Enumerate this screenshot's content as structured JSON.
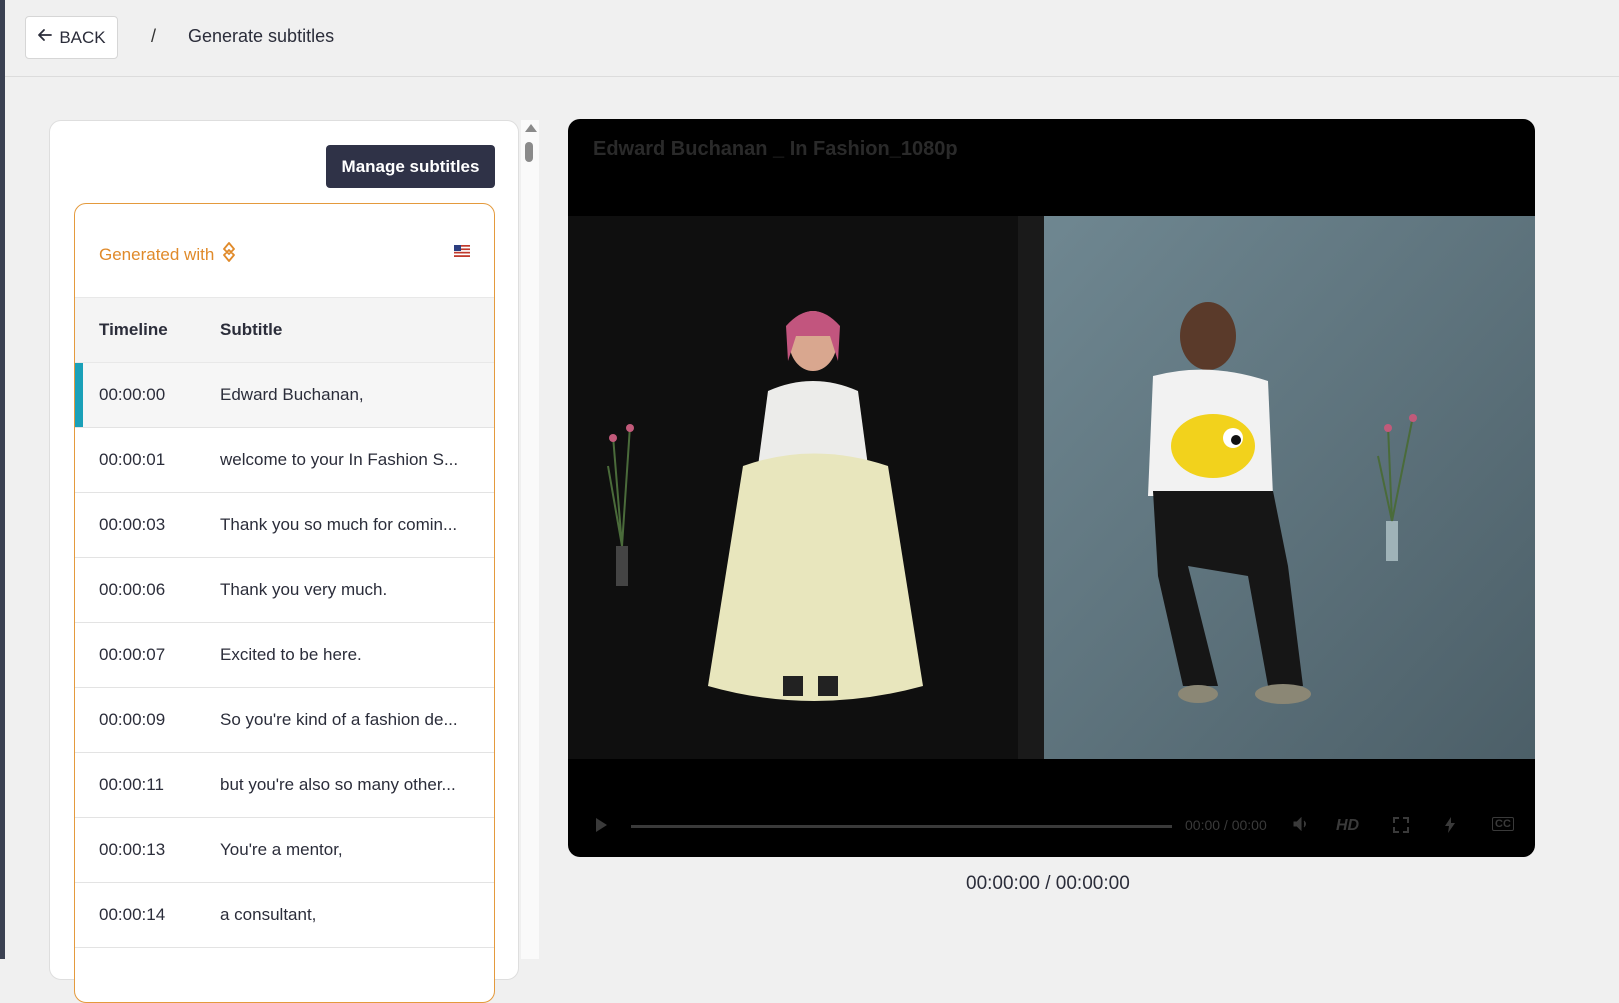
{
  "topbar": {
    "back_label": "BACK",
    "separator": "/",
    "title": "Generate subtitles"
  },
  "panel": {
    "manage_button": "Manage subtitles",
    "generated_with": "Generated with",
    "flag_icon": "us-flag-icon",
    "columns": {
      "timeline": "Timeline",
      "subtitle": "Subtitle"
    },
    "rows": [
      {
        "time": "00:00:00",
        "text": "Edward Buchanan,",
        "active": true
      },
      {
        "time": "00:00:01",
        "text": "welcome to your In Fashion S..."
      },
      {
        "time": "00:00:03",
        "text": "Thank you so much for comin..."
      },
      {
        "time": "00:00:06",
        "text": "Thank you very much."
      },
      {
        "time": "00:00:07",
        "text": "Excited to be here."
      },
      {
        "time": "00:00:09",
        "text": "So you're kind of a fashion de..."
      },
      {
        "time": "00:00:11",
        "text": "but you're also so many other..."
      },
      {
        "time": "00:00:13",
        "text": "You're a mentor,"
      },
      {
        "time": "00:00:14",
        "text": "a consultant,"
      }
    ]
  },
  "player": {
    "title": "Edward Buchanan _ In Fashion_1080p",
    "control_time": "00:00 / 00:00",
    "hd_label": "HD",
    "cc_label": "CC",
    "time_display": "00:00:00 / 00:00:00"
  },
  "colors": {
    "accent_orange": "#e08a2a",
    "active_bar": "#1aa0b8",
    "button_dark": "#2f3247"
  }
}
